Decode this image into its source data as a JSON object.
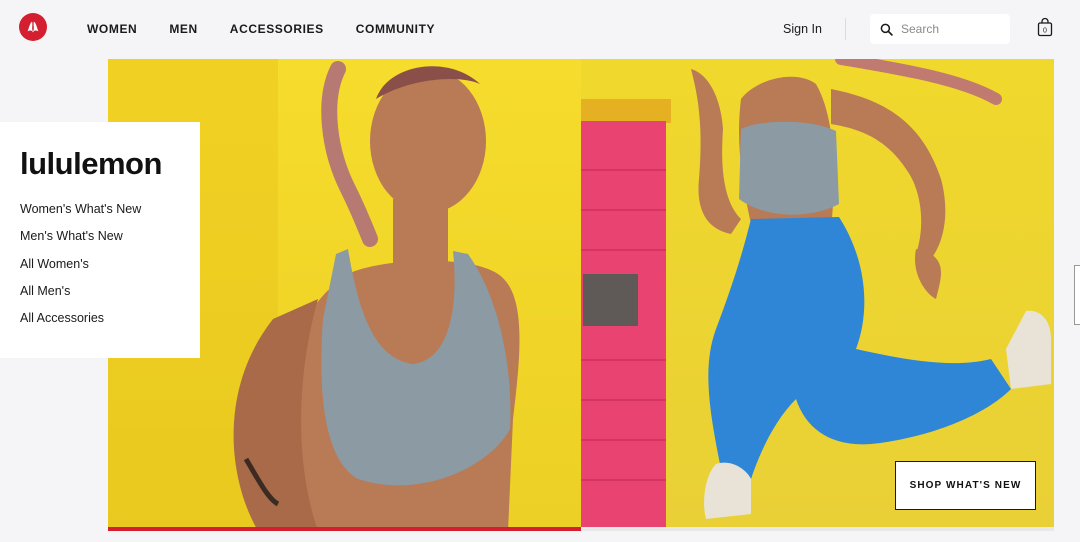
{
  "header": {
    "nav": [
      "WOMEN",
      "MEN",
      "ACCESSORIES",
      "COMMUNITY"
    ],
    "sign_in": "Sign In",
    "search_placeholder": "Search",
    "bag_count": "0"
  },
  "menu": {
    "brand": "lululemon",
    "items": [
      "Women's What's New",
      "Men's What's New",
      "All Women's",
      "All Men's",
      "All Accessories"
    ]
  },
  "hero": {
    "cta_label": "SHOP WHAT'S NEW",
    "carousel_progress": 0.5
  },
  "colors": {
    "brand_red": "#d31f2f",
    "hero_yellow": "#f2da2a",
    "door_pink": "#e94372",
    "legging_blue": "#2f86d6"
  },
  "icons": [
    "lululemon-logo-icon",
    "search-icon",
    "shopping-bag-icon"
  ]
}
